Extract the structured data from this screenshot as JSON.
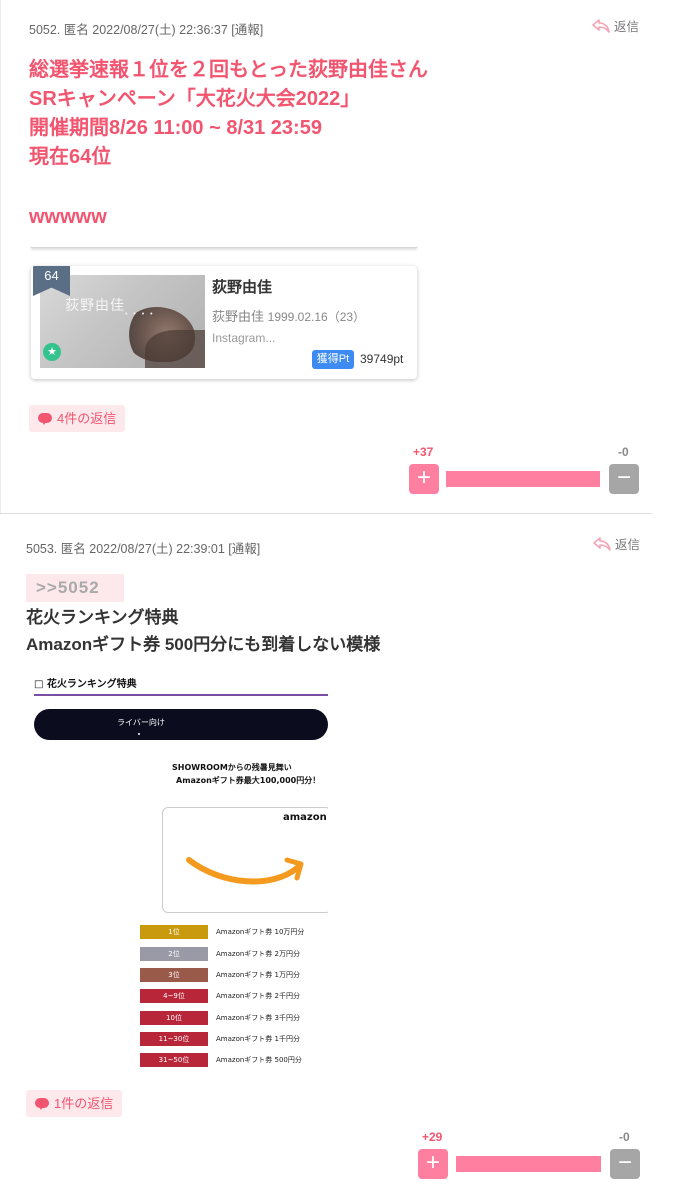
{
  "posts": [
    {
      "meta": {
        "number": "5052.",
        "name": "匿名",
        "datetime": "2022/08/27(土) 22:36:37",
        "report": "[通報]"
      },
      "reply_label": "返信",
      "body_lines": [
        "総選挙速報１位を２回もとった荻野由佳さん",
        "SRキャンペーン「大花火大会2022」",
        "開催期間8/26 11:00 ~ 8/31 23:59",
        "現在64位",
        "",
        "wwwww"
      ],
      "card": {
        "rank": "64",
        "thumb_watermark": "荻野由佳",
        "thumb_watermark_sub": "• • • •",
        "name": "荻野由佳",
        "sub_name": "荻野由佳",
        "birth": "1999.02.16（23）",
        "desc": "Instagram...",
        "pt_label": "獲得Pt",
        "pt_value": "39749pt",
        "star_icon": "★"
      },
      "replies_label": "4件の返信",
      "votes": {
        "up": "+37",
        "down": "-0",
        "up_share": 1.0
      }
    },
    {
      "meta": {
        "number": "5053.",
        "name": "匿名",
        "datetime": "2022/08/27(土) 22:39:01",
        "report": "[通報]"
      },
      "reply_label": "返信",
      "anchor": ">>5052",
      "body_lines": [
        "花火ランキング特典",
        "Amazonギフト券 500円分にも到着しない模様"
      ],
      "promo": {
        "heading": "□ 花火ランキング特典",
        "pill": "ライバー向け",
        "line1": "SHOWROOMからの残暑見舞い",
        "line2": "Amazonギフト券最大100,000円分！",
        "logo": "amazon",
        "tiers": [
          {
            "rank": "1位",
            "prize": "Amazonギフト券 10万円分",
            "color": "#c99a0e"
          },
          {
            "rank": "2位",
            "prize": "Amazonギフト券 2万円分",
            "color": "#9a9aa6"
          },
          {
            "rank": "3位",
            "prize": "Amazonギフト券 1万円分",
            "color": "#9a5a4a"
          },
          {
            "rank": "4~9位",
            "prize": "Amazonギフト券 2千円分",
            "color": "#b8263a"
          },
          {
            "rank": "10位",
            "prize": "Amazonギフト券 3千円分",
            "color": "#b8263a"
          },
          {
            "rank": "11~30位",
            "prize": "Amazonギフト券 1千円分",
            "color": "#b8263a"
          },
          {
            "rank": "31~50位",
            "prize": "Amazonギフト券 500円分",
            "color": "#b8263a"
          }
        ]
      },
      "replies_label": "1件の返信",
      "votes": {
        "up": "+29",
        "down": "-0",
        "up_share": 1.0
      }
    }
  ],
  "colors": {
    "accent_pink": "#f2556f",
    "vote_pink": "#ff7fa0",
    "vote_gray": "#a6a6a6",
    "chip_bg": "#fde8ec",
    "pt_blue": "#3d8bf2"
  },
  "icons": {
    "reply": "reply-arrow-icon",
    "bubble": "speech-bubble-icon",
    "plus": "+",
    "minus": "−"
  }
}
